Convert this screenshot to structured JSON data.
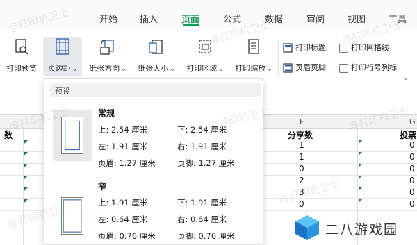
{
  "tabs": [
    {
      "label": "开始",
      "active": false
    },
    {
      "label": "插入",
      "active": false
    },
    {
      "label": "页面",
      "active": true
    },
    {
      "label": "公式",
      "active": false
    },
    {
      "label": "数据",
      "active": false
    },
    {
      "label": "审阅",
      "active": false
    },
    {
      "label": "视图",
      "active": false
    },
    {
      "label": "工具",
      "active": false
    }
  ],
  "ribbon": {
    "print_preview": "打印预览",
    "margins": "页边距",
    "orientation": "纸张方向",
    "size": "纸张大小",
    "print_area": "打印区域",
    "print_scale": "打印缩放",
    "print_titles": "打印标题",
    "header_footer": "页眉页脚",
    "print_gridlines": "打印网格线",
    "print_headings": "打印行号列标"
  },
  "sheet": {
    "col_f": "F",
    "col_g": "G",
    "header_left": "数",
    "header_share": "分享数",
    "header_vote": "投票",
    "share_values": [
      "1",
      "1",
      "0",
      "2",
      "3",
      "0"
    ],
    "vote_values": [
      "0",
      "0",
      "0",
      "0",
      "0",
      "0"
    ]
  },
  "margins_panel": {
    "section": "预设",
    "presets": [
      {
        "name": "常规",
        "top": "上: 2.54 厘米",
        "bottom": "下: 2.54 厘米",
        "left": "左: 1.91 厘米",
        "right": "右: 1.91 厘米",
        "header": "页眉: 1.27 厘米",
        "footer": "页脚: 1.27 厘米"
      },
      {
        "name": "窄",
        "top": "上: 1.91 厘米",
        "bottom": "下: 1.91 厘米",
        "left": "左: 0.64 厘米",
        "right": "右: 0.64 厘米",
        "header": "页眉: 0.76 厘米",
        "footer": "页脚: 0.76 厘米"
      }
    ]
  },
  "watermark": "@打印机卫士",
  "logo_text": "二八游戏园",
  "colors": {
    "accent": "#169b54",
    "ribbon_icon": "#2b5fa8",
    "selected_bg": "#e6e8eb"
  }
}
